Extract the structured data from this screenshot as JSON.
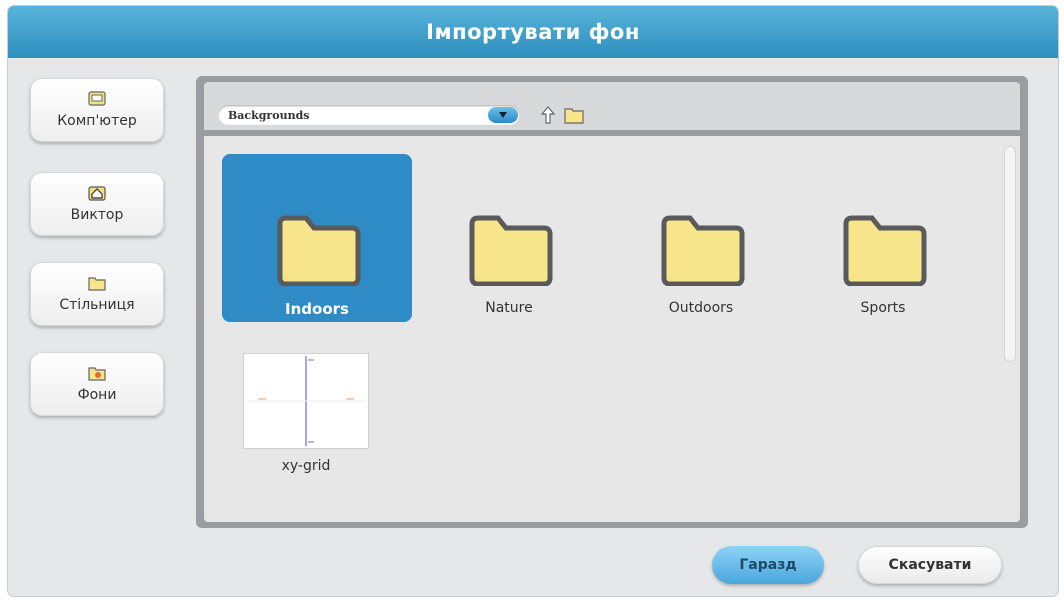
{
  "dialog": {
    "title": "Імпортувати фон"
  },
  "sidebar": {
    "items": [
      {
        "label": "Комп'ютер",
        "icon": "computer-icon"
      },
      {
        "label": "Виктор",
        "icon": "home-icon"
      },
      {
        "label": "Стільниця",
        "icon": "folder-icon"
      },
      {
        "label": "Фони",
        "icon": "backgrounds-icon"
      }
    ]
  },
  "path": {
    "selected": "Backgrounds"
  },
  "files": {
    "folders": [
      {
        "name": "Indoors",
        "selected": true
      },
      {
        "name": "Nature",
        "selected": false
      },
      {
        "name": "Outdoors",
        "selected": false
      },
      {
        "name": "Sports",
        "selected": false
      }
    ],
    "images": [
      {
        "name": "xy-grid"
      }
    ]
  },
  "buttons": {
    "ok": "Гаразд",
    "cancel": "Скасувати"
  },
  "colors": {
    "accent": "#2e8bc6",
    "folder_fill": "#f6e58a",
    "folder_outline": "#5a5a5a"
  }
}
